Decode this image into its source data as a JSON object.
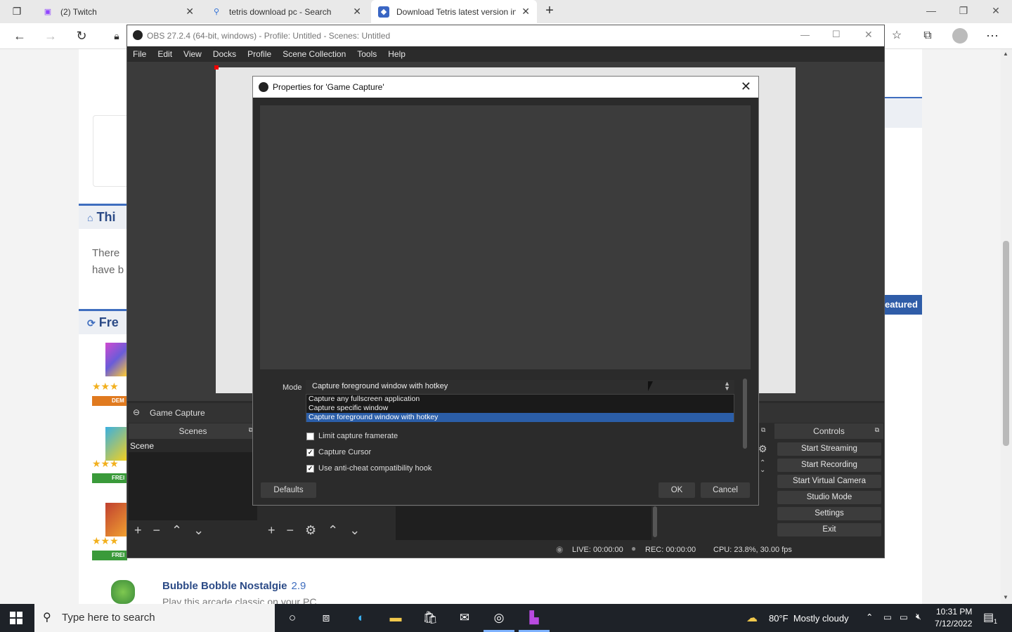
{
  "browser": {
    "tabs": [
      {
        "label": "(2) Twitch",
        "icon": "twitch-icon"
      },
      {
        "label": "tetris download pc - Search",
        "icon": "search-icon"
      },
      {
        "label": "Download Tetris latest version in",
        "icon": "site-icon"
      }
    ],
    "new_tab": "+"
  },
  "webpage": {
    "section1": "Thi",
    "body1": "There",
    "body2": "have b",
    "section2": "Fre",
    "featured": "eatured",
    "badge_demo": "DEM",
    "badge_free": "FREI",
    "bubble_title": "Bubble Bobble Nostalgie",
    "bubble_rating": "2.9",
    "bubble_sub": "Play this arcade classic on your PC"
  },
  "obs": {
    "title": "OBS 27.2.4 (64-bit, windows) - Profile: Untitled - Scenes: Untitled",
    "menu": [
      "File",
      "Edit",
      "View",
      "Docks",
      "Profile",
      "Scene Collection",
      "Tools",
      "Help"
    ],
    "source_name": "Game Capture",
    "scenes_header": "Scenes",
    "scene_item": "Scene",
    "controls_header": "Controls",
    "controls": [
      "Start Streaming",
      "Start Recording",
      "Start Virtual Camera",
      "Studio Mode",
      "Settings",
      "Exit"
    ],
    "status": {
      "live": "LIVE: 00:00:00",
      "rec": "REC: 00:00:00",
      "cpu": "CPU: 23.8%, 30.00 fps"
    }
  },
  "dialog": {
    "title": "Properties for 'Game Capture'",
    "mode_label": "Mode",
    "mode_value": "Capture foreground window with hotkey",
    "mode_options": [
      "Capture any fullscreen application",
      "Capture specific window",
      "Capture foreground window with hotkey"
    ],
    "mode_selected_index": 2,
    "checkboxes": [
      {
        "label": "Limit capture framerate",
        "checked": false
      },
      {
        "label": "Capture Cursor",
        "checked": true
      },
      {
        "label": "Use anti-cheat compatibility hook",
        "checked": true
      }
    ],
    "defaults_btn": "Defaults",
    "ok_btn": "OK",
    "cancel_btn": "Cancel"
  },
  "taskbar": {
    "search_placeholder": "Type here to search",
    "weather": "80°F  Mostly cloudy",
    "time": "10:31 PM",
    "date": "7/12/2022",
    "notifications": "1"
  }
}
